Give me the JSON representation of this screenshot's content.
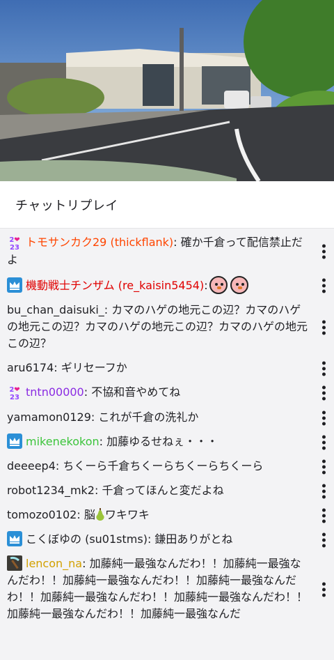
{
  "chat": {
    "title": "チャットリプレイ",
    "messages": [
      {
        "badge": "sub-23",
        "user": "トモサンカク29 (thickflank)",
        "color": "#ff4500",
        "text": ": 確か千倉って配信禁止だよ"
      },
      {
        "badge": "crown",
        "user": "機動戦士チンザム (re_kaisin5454)",
        "color": "#e00000",
        "text": ":",
        "emotes": 2
      },
      {
        "badge": "none",
        "user": "bu_chan_daisuki_",
        "color": "#1f1f23",
        "text": ": カマのハゲの地元この辺？カマのハゲの地元この辺？カマのハゲの地元この辺？カマのハゲの地元この辺？"
      },
      {
        "badge": "none",
        "user": "aru6174",
        "color": "#1f1f23",
        "text": ": ギリセーフか"
      },
      {
        "badge": "sub-23",
        "user": "tntn00000",
        "color": "#8a2be2",
        "text": ": 不協和音やめてね"
      },
      {
        "badge": "none",
        "user": "yamamon0129",
        "color": "#1f1f23",
        "text": ": これが千倉の洗礼か"
      },
      {
        "badge": "crown",
        "user": "mikenekokon",
        "color": "#3cc43c",
        "text": ": 加藤ゆるせねぇ・・・"
      },
      {
        "badge": "none",
        "user": "deeeep4",
        "color": "#1f1f23",
        "text": ": ちくーら千倉ちくーらちくーらちくーら"
      },
      {
        "badge": "none",
        "user": "robot1234_mk2",
        "color": "#1f1f23",
        "text": ": 千倉ってほんと変だよね"
      },
      {
        "badge": "none",
        "user": "tomozo0102",
        "color": "#1f1f23",
        "text": ": 脳",
        "after_icon": "pear-icon",
        "text2": "ワキワキ"
      },
      {
        "badge": "crown",
        "user": "こくぼゆの (su01stms)",
        "color": "#1f1f23",
        "text": ": 鎌田ありがとね"
      },
      {
        "badge": "pickaxe",
        "user": "lencon_na",
        "color": "#d2a000",
        "text": ": 加藤純一最強なんだわ！！加藤純一最強なんだわ！！加藤純一最強なんだわ！！加藤純一最強なんだわ！！加藤純一最強なんだわ！！加藤純一最強なんだわ！！加藤純一最強なんだわ！！加藤純一最強なんだ"
      }
    ]
  },
  "icons": {
    "more": "more-vertical-icon",
    "crown": "crown-icon",
    "sub": "sub-badge-icon",
    "pickaxe": "pickaxe-icon"
  },
  "colors": {
    "chat_bg": "#f3f3f5",
    "crown_badge": "#2b8fd6"
  }
}
